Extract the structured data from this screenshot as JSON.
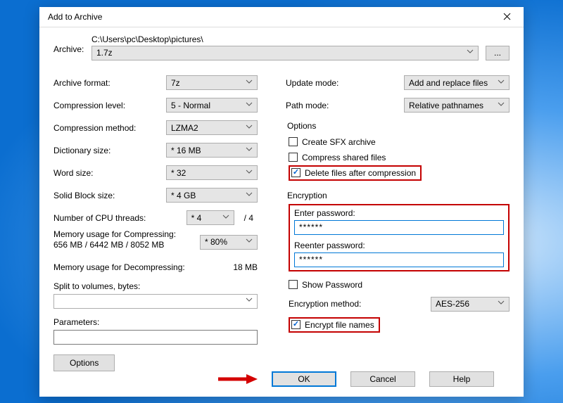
{
  "title": "Add to Archive",
  "archive": {
    "label": "Archive:",
    "path": "C:\\Users\\pc\\Desktop\\pictures\\",
    "filename": "1.7z",
    "browse_label": "..."
  },
  "left": {
    "format": {
      "label": "Archive format:",
      "value": "7z"
    },
    "level": {
      "label": "Compression level:",
      "value": "5 - Normal"
    },
    "method": {
      "label": "Compression method:",
      "value": "LZMA2"
    },
    "dict": {
      "label": "Dictionary size:",
      "value": "* 16 MB"
    },
    "word": {
      "label": "Word size:",
      "value": "* 32"
    },
    "block": {
      "label": "Solid Block size:",
      "value": "* 4 GB"
    },
    "threads": {
      "label": "Number of CPU threads:",
      "value": "* 4",
      "total": "/ 4"
    },
    "mem_compress": {
      "label": "Memory usage for Compressing:",
      "detail": "656 MB / 6442 MB / 8052 MB",
      "value": "* 80%"
    },
    "mem_decompress": {
      "label": "Memory usage for Decompressing:",
      "value": "18 MB"
    },
    "split": {
      "label": "Split to volumes, bytes:",
      "value": ""
    },
    "params": {
      "label": "Parameters:",
      "value": ""
    },
    "options_btn": "Options"
  },
  "right": {
    "update": {
      "label": "Update mode:",
      "value": "Add and replace files"
    },
    "pathmode": {
      "label": "Path mode:",
      "value": "Relative pathnames"
    },
    "options_label": "Options",
    "opt_sfx": "Create SFX archive",
    "opt_shared": "Compress shared files",
    "opt_delete": "Delete files after compression",
    "encryption_label": "Encryption",
    "pw1_label": "Enter password:",
    "pw1_value": "******",
    "pw2_label": "Reenter password:",
    "pw2_value": "******",
    "show_pw": "Show Password",
    "enc_method": {
      "label": "Encryption method:",
      "value": "AES-256"
    },
    "enc_names": "Encrypt file names"
  },
  "footer": {
    "ok": "OK",
    "cancel": "Cancel",
    "help": "Help"
  }
}
